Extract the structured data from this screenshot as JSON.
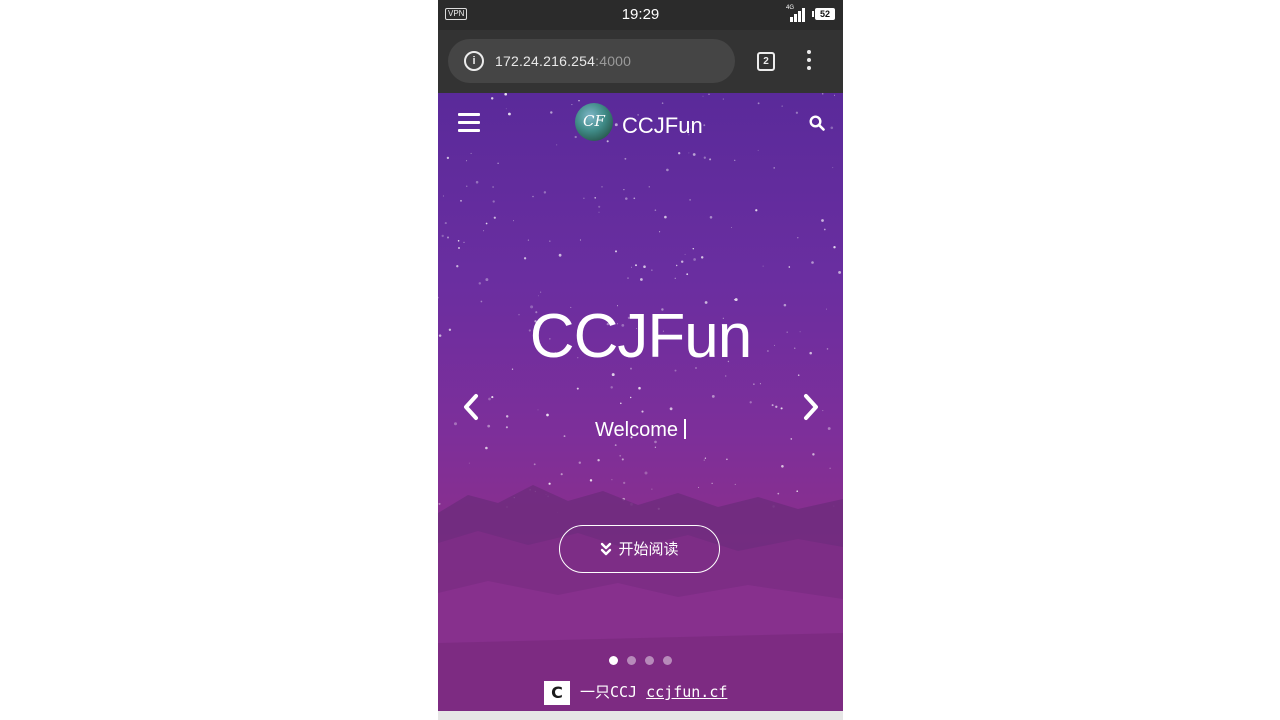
{
  "status_bar": {
    "vpn": "VPN",
    "time": "19:29",
    "network": "4G",
    "battery": "52"
  },
  "browser": {
    "url_host": "172.24.216.254",
    "url_port": ":4000",
    "tab_count": "2"
  },
  "site": {
    "name": "CCJFun",
    "logo_text": "CF"
  },
  "hero": {
    "title": "CCJFun",
    "subtitle": "Welcome",
    "cta_label": "开始阅读",
    "slides_total": 4,
    "active_slide": 1
  },
  "watermark": {
    "icon_letter": "C",
    "text": "一只CCJ",
    "site": "ccjfun.cf"
  },
  "colors": {
    "hero_top": "#5a2a9a",
    "hero_bottom": "#8a2f8c",
    "browser_bar": "#333333"
  },
  "icons": [
    "info-icon",
    "tab-switcher-icon",
    "overflow-menu-icon",
    "hamburger-menu-icon",
    "search-icon",
    "chevron-left-icon",
    "chevron-right-icon",
    "double-chevron-down-icon"
  ]
}
